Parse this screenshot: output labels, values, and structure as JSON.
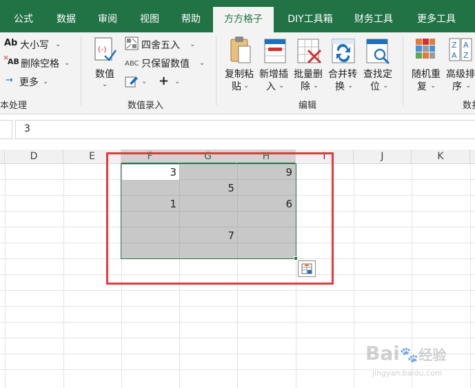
{
  "tabs": [
    {
      "label": "公式"
    },
    {
      "label": "数据"
    },
    {
      "label": "审阅"
    },
    {
      "label": "视图"
    },
    {
      "label": "帮助"
    },
    {
      "label": "方方格子"
    },
    {
      "label": "DIY工具箱"
    },
    {
      "label": "财务工具"
    },
    {
      "label": "更多工具"
    }
  ],
  "ribbon": {
    "text_group": {
      "case_label": "大小写",
      "case_prefix": "Ab",
      "delete_space_label": "删除空格",
      "delete_space_prefix": "AB",
      "more_label": "更多",
      "group_name": "本处理"
    },
    "number_group": {
      "numeric_label": "数值",
      "round_label": "四舍五入",
      "keep_numeric_label": "只保留数值",
      "keep_prefix": "ABC",
      "group_name": "数值录入"
    },
    "edit_group": {
      "copy_paste_label_1": "复制粘",
      "copy_paste_label_2": "贴",
      "add_insert_label_1": "新增插",
      "add_insert_label_2": "入",
      "batch_delete_label_1": "批量删",
      "batch_delete_label_2": "除",
      "merge_convert_label_1": "合并转",
      "merge_convert_label_2": "换",
      "find_locate_label_1": "查找定",
      "find_locate_label_2": "位",
      "group_name": "编辑"
    },
    "data_group": {
      "random_label_1": "随机重",
      "random_label_2": "复",
      "advanced_sort_label_1": "高级排",
      "advanced_sort_label_2": "序",
      "sort_icon_letters": "ZAAZ",
      "group_name": "数扌"
    }
  },
  "formula_bar": {
    "value": "3"
  },
  "columns": [
    "D",
    "E",
    "F",
    "G",
    "H",
    "I",
    "J",
    "K"
  ],
  "cells": {
    "F1": "3",
    "H1": "9",
    "G2": "5",
    "F3": "1",
    "H3": "6",
    "G5": "7"
  },
  "watermark": {
    "brand": "Bai",
    "brand_suffix": "经验",
    "url": "jingyan.baidu.com"
  },
  "colors": {
    "excel_green": "#217346",
    "selection_gray": "#c8c8c8",
    "highlight_red": "#e4393c"
  }
}
